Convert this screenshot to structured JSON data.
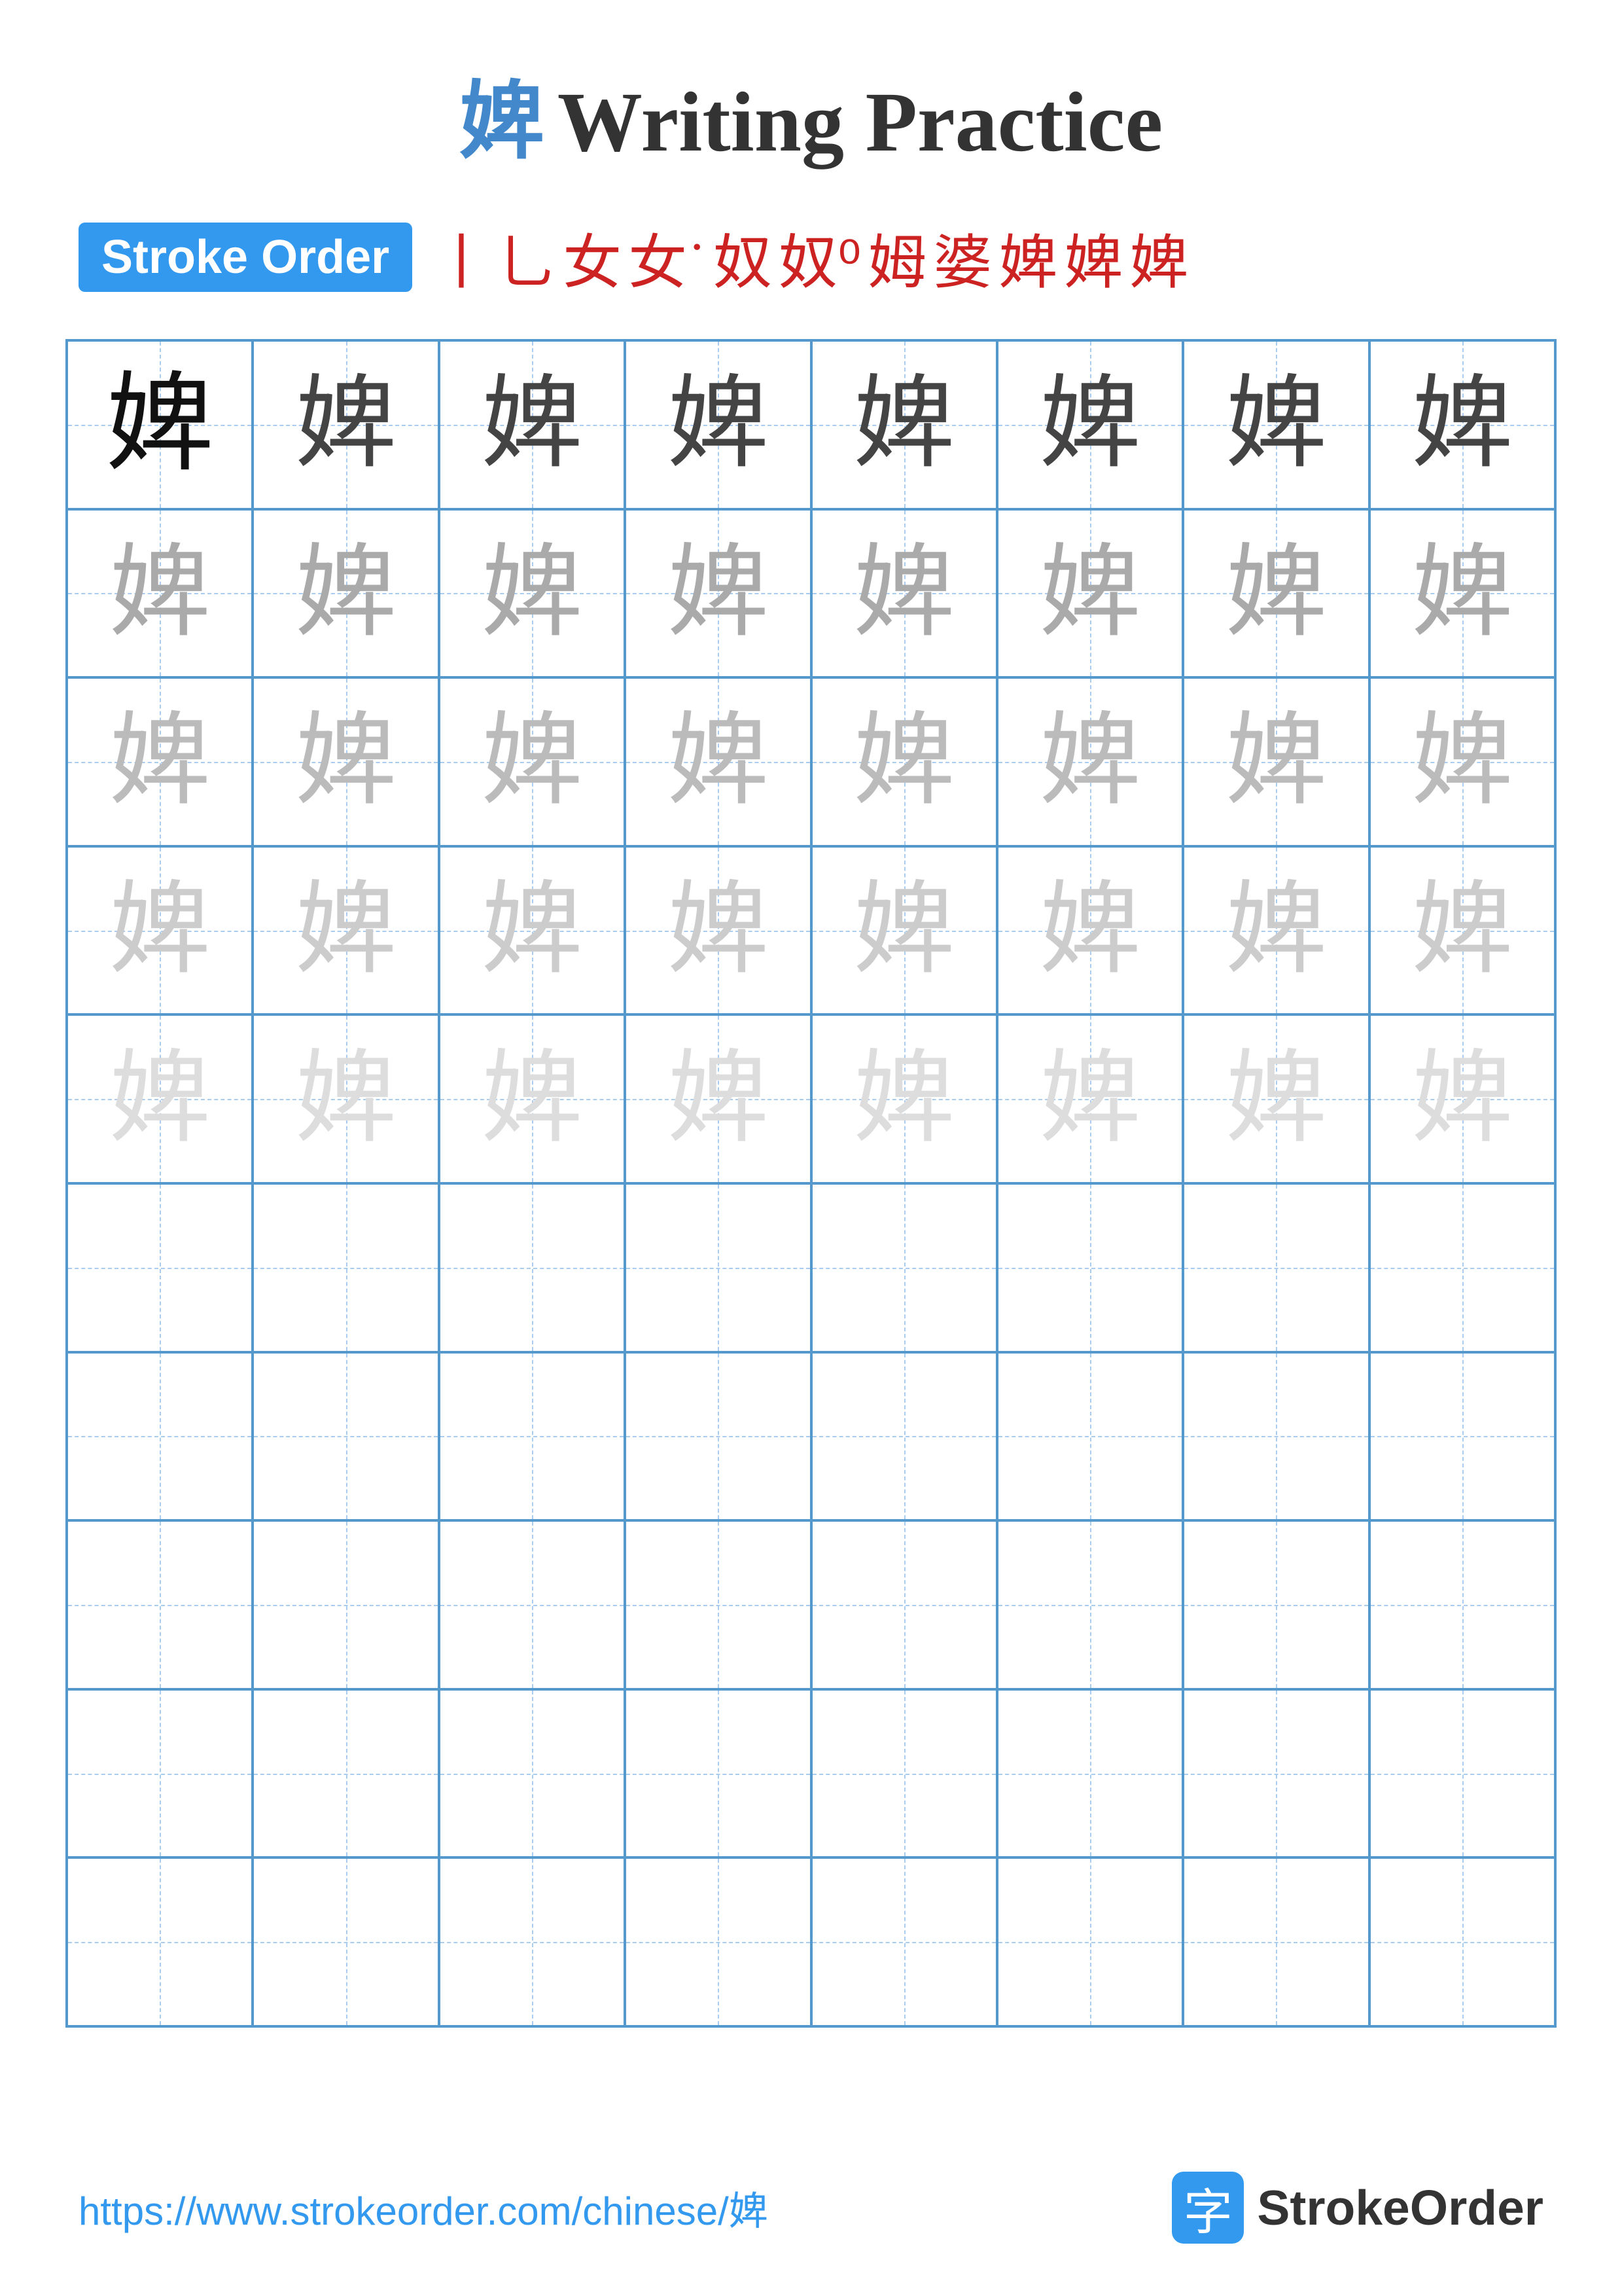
{
  "title": {
    "char": "婢",
    "text": "Writing Practice",
    "full": "婢 Writing Practice"
  },
  "stroke_order": {
    "badge_label": "Stroke Order",
    "chars": [
      "丨",
      "乚",
      "女",
      "女˙",
      "奴",
      "奴⁰",
      "姆",
      "婆",
      "婢",
      "婢⁻",
      "婢"
    ]
  },
  "grid": {
    "rows": 10,
    "cols": 8,
    "char": "婢",
    "filled_rows": 5
  },
  "footer": {
    "url": "https://www.strokeorder.com/chinese/婢",
    "brand_name": "StrokeOrder",
    "brand_icon": "字"
  }
}
